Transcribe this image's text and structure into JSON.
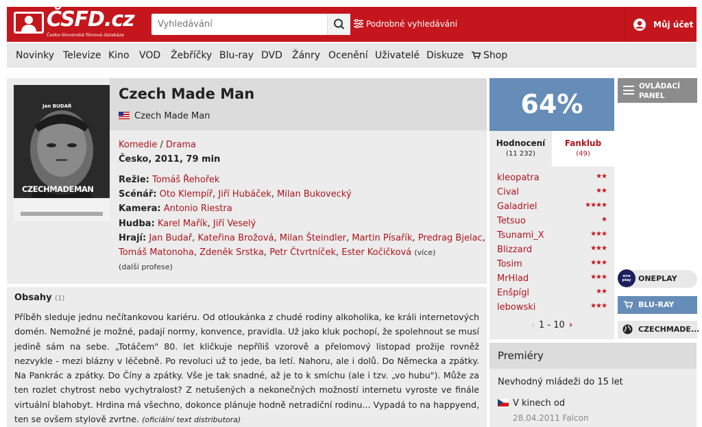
{
  "header": {
    "logo_text": "ČSFD.cz",
    "logo_subtitle": "Česko-Slovenská filmová databáze",
    "search_placeholder": "Vyhledávání",
    "advanced_search": "Podrobné vyhledávání",
    "account": "Můj účet"
  },
  "nav": {
    "items": [
      "Novinky",
      "Televize",
      "Kino",
      "VOD",
      "Žebříčky",
      "Blu-ray",
      "DVD",
      "Žánry",
      "Ocenění",
      "Uživatelé",
      "Diskuze",
      "Shop"
    ]
  },
  "film": {
    "title": "Czech Made Man",
    "original_title": "Czech Made Man",
    "genres": [
      "Komedie",
      "Drama"
    ],
    "genre_sep": "/",
    "origin": "Česko, 2011, 79 min",
    "credits": {
      "rezie_label": "Režie:",
      "rezie": "Tomáš Řehořek",
      "scenar_label": "Scénář:",
      "scenar": [
        "Oto Klempíř",
        "Jiří Hubáček",
        "Milan Bukovecký"
      ],
      "kamera_label": "Kamera:",
      "kamera": "Antonio Riestra",
      "hudba_label": "Hudba:",
      "hudba": [
        "Karel Mařík",
        "Jiří Veselý"
      ],
      "hraji_label": "Hrají:",
      "hraji_line1": [
        "Jan Budař",
        "Kateřina Brožová",
        "Milan Šteindler",
        "Martin Písařík",
        "Predrag Bjelac"
      ],
      "hraji_line2": [
        "Tomáš Matonoha",
        "Zdeněk Srstka",
        "Petr Čtvrtníček",
        "Ester Kočičková"
      ],
      "more": "(více)",
      "more_professions": "(další profese)"
    },
    "poster": {
      "actor_name": "Jan BUDAŘ",
      "title_text": "CZECHMADEMAN"
    }
  },
  "content": {
    "heading": "Obsahy",
    "count": "(1)",
    "text": "Příběh sleduje jednu nečítankovou kariéru. Od otloukánka z chudé rodiny alkoholika, ke králi internetových domén. Nemožné je možné, padají normy, konvence, pravidla. Už jako kluk pochopí, že spolehnout se musí jedině sám na sebe. „Totáčem\" 80. let kličkuje nepříliš vzorově a přelomový listopad prožije rovněž nezvykle - mezi blázny v léčebně. Po revoluci už to jede, ba letí. Nahoru, ale i dolů. Do Německa a zpátky. Na Pankrác a zpátky. Do Číny a zpátky. Vše je tak snadné, až je to k smíchu (ale i tzv. „vo hubu\"). Může za ten rozlet chytrost nebo vychytralost? Z netušených a nekonečných možností internetu vyroste ve finále virtuální blahobyt. Hrdina má všechno, dokonce plánuje hodně netradiční rodinu... Vypadá to na happyend, ten se ovšem stylově zvrtne.",
    "source": "(oficiální text distributora)"
  },
  "rating": {
    "percent": "64%",
    "tab_ratings": "Hodnocení",
    "tab_ratings_count": "(11 232)",
    "tab_fanclub": "Fanklub",
    "tab_fanclub_count": "(49)",
    "users": [
      {
        "name": "kleopatra",
        "stars": "★★"
      },
      {
        "name": "Cival",
        "stars": "★★"
      },
      {
        "name": "Galadriel",
        "stars": "★★★★"
      },
      {
        "name": "Tetsuo",
        "stars": "★"
      },
      {
        "name": "Tsunami_X",
        "stars": "★★★"
      },
      {
        "name": "Blizzard",
        "stars": "★★★"
      },
      {
        "name": "Tosim",
        "stars": "★★★"
      },
      {
        "name": "MrHlad",
        "stars": "★★★"
      },
      {
        "name": "Enšpígl",
        "stars": "★★"
      },
      {
        "name": "lebowski",
        "stars": "★★★"
      }
    ],
    "pager": "1 - 10",
    "colors": {
      "rating_box": "#658db8",
      "accent": "#c4161c"
    }
  },
  "sidebar": {
    "control_panel": "OVLÁDACÍ PANEL",
    "oneplay": "ONEPLAY",
    "oneplay_logo": "one play",
    "bluray": "BLU-RAY",
    "web": "CZECHMADE..."
  },
  "premieres": {
    "heading": "Premiéry",
    "age": "Nevhodný mládeži do 15 let",
    "cinema": "V kinech od",
    "date": "28.04.2011 Falcon"
  }
}
